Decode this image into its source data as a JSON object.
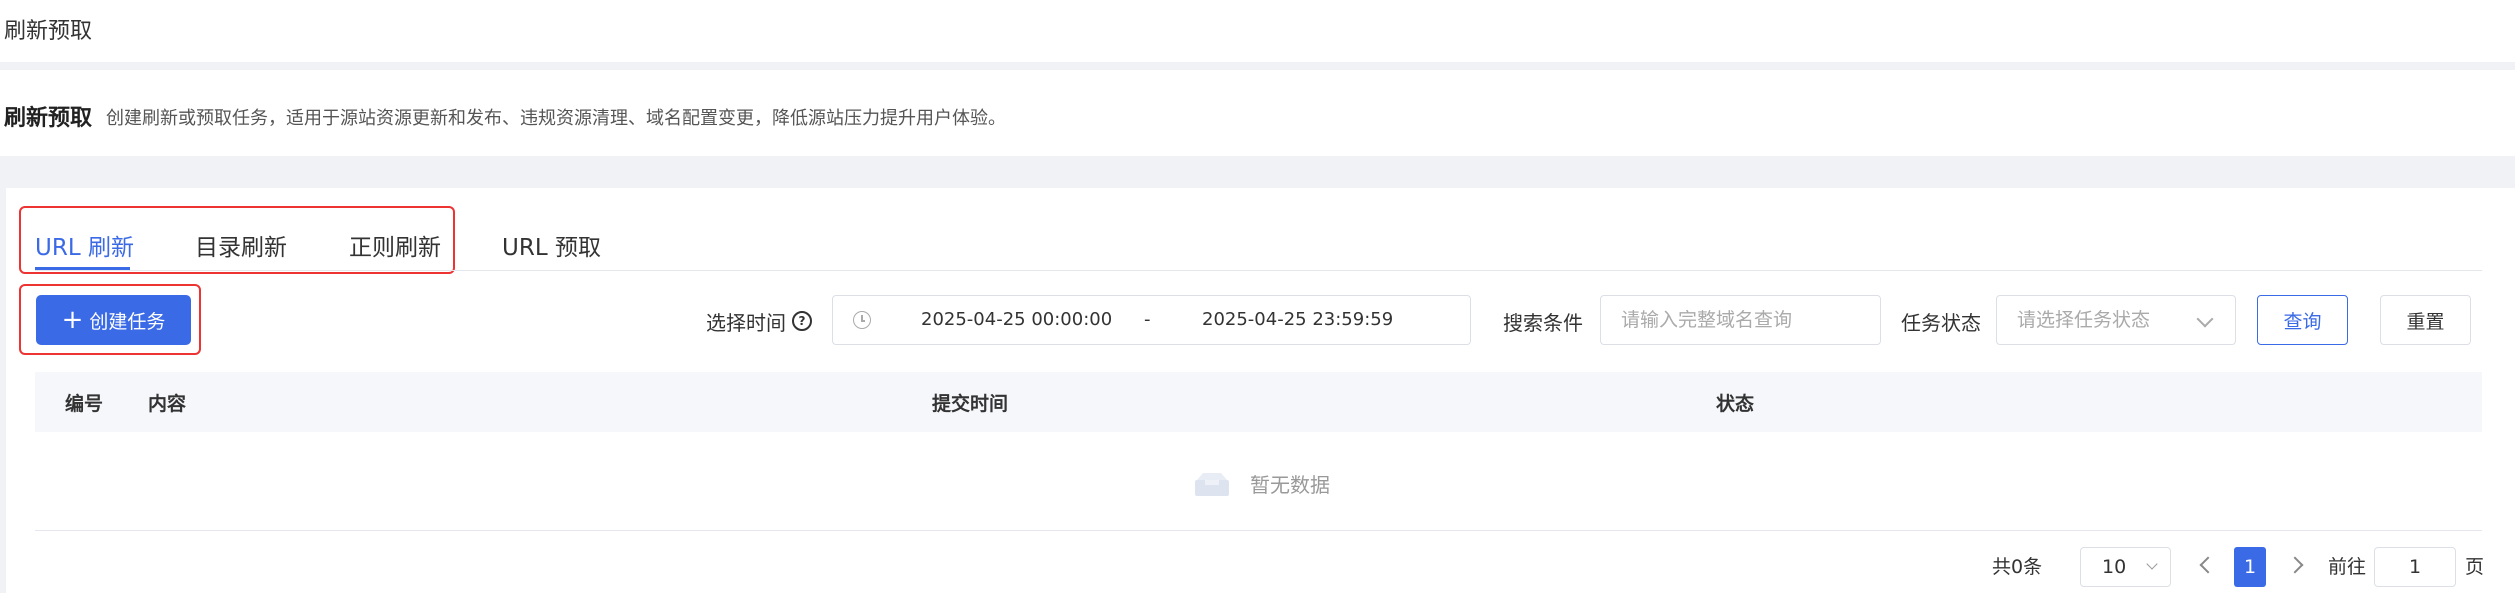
{
  "header": {
    "title": "刷新预取"
  },
  "intro": {
    "title": "刷新预取",
    "description": "创建刷新或预取任务，适用于源站资源更新和发布、违规资源清理、域名配置变更，降低源站压力提升用户体验。"
  },
  "tabs": [
    {
      "label": "URL 刷新",
      "active": true
    },
    {
      "label": "目录刷新",
      "active": false
    },
    {
      "label": "正则刷新",
      "active": false
    },
    {
      "label": "URL 预取",
      "active": false
    }
  ],
  "toolbar": {
    "create_label": "创建任务",
    "time_label": "选择时间",
    "start_time": "2025-04-25 00:00:00",
    "range_separator": "-",
    "end_time": "2025-04-25 23:59:59",
    "search_label": "搜索条件",
    "search_placeholder": "请输入完整域名查询",
    "status_label": "任务状态",
    "status_placeholder": "请选择任务状态",
    "query_label": "查询",
    "reset_label": "重置"
  },
  "table": {
    "columns": [
      "编号",
      "内容",
      "提交时间",
      "状态"
    ],
    "rows": [],
    "empty_text": "暂无数据"
  },
  "pagination": {
    "total_text": "共0条",
    "page_size": "10",
    "current_page": "1",
    "goto_label": "前往",
    "goto_value": "1",
    "page_suffix": "页"
  },
  "colors": {
    "accent": "#3b6ae6",
    "highlight_border": "#ee3333"
  },
  "icons": {
    "create": "plus-icon",
    "help": "question-circle-icon",
    "clock": "clock-icon",
    "empty": "empty-box-icon"
  }
}
